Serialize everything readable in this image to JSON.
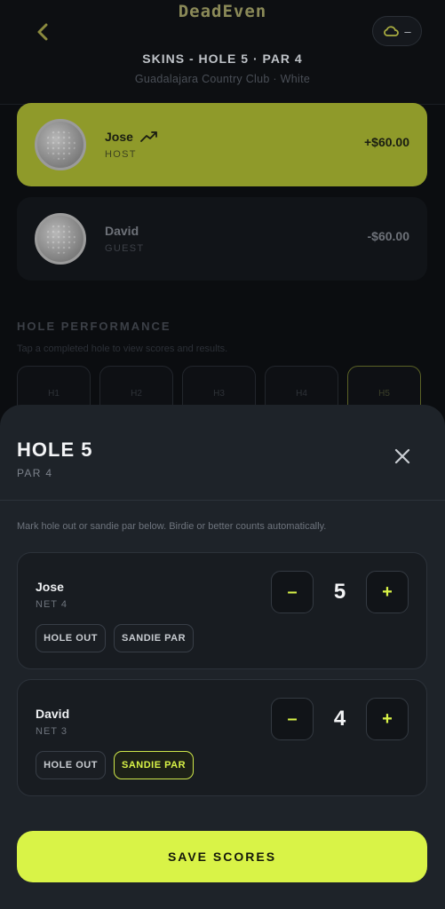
{
  "app": {
    "logo": "DeadEven"
  },
  "header": {
    "title": "SKINS - HOLE 5 · PAR 4",
    "subtitle": "Guadalajara Country Club · White",
    "weather_value": "–"
  },
  "players": [
    {
      "name": "Jose",
      "role": "HOST",
      "amount": "+$60.00",
      "trend": "trending-up-icon"
    },
    {
      "name": "David",
      "role": "GUEST",
      "amount": "-$60.00"
    }
  ],
  "hole_performance": {
    "title": "HOLE PERFORMANCE",
    "subtitle": "Tap a completed hole to view scores and results.",
    "holes": [
      "H1",
      "H2",
      "H3",
      "H4",
      "H5"
    ]
  },
  "sheet": {
    "title": "HOLE 5",
    "par": "PAR 4",
    "note": "Mark hole out or sandie par below. Birdie or better counts automatically.",
    "scores": [
      {
        "name": "Jose",
        "net": "NET 4",
        "score": "5",
        "hole_out": "HOLE OUT",
        "sandie_par": "SANDIE PAR",
        "sandie_active": false
      },
      {
        "name": "David",
        "net": "NET 3",
        "score": "4",
        "hole_out": "HOLE OUT",
        "sandie_par": "SANDIE PAR",
        "sandie_active": true
      }
    ],
    "minus_label": "–",
    "plus_label": "+",
    "save_label": "SAVE SCORES"
  },
  "colors": {
    "accent": "#d9f347",
    "sheet_bg": "#1e2329",
    "leader_card": "#8f9a2a"
  }
}
